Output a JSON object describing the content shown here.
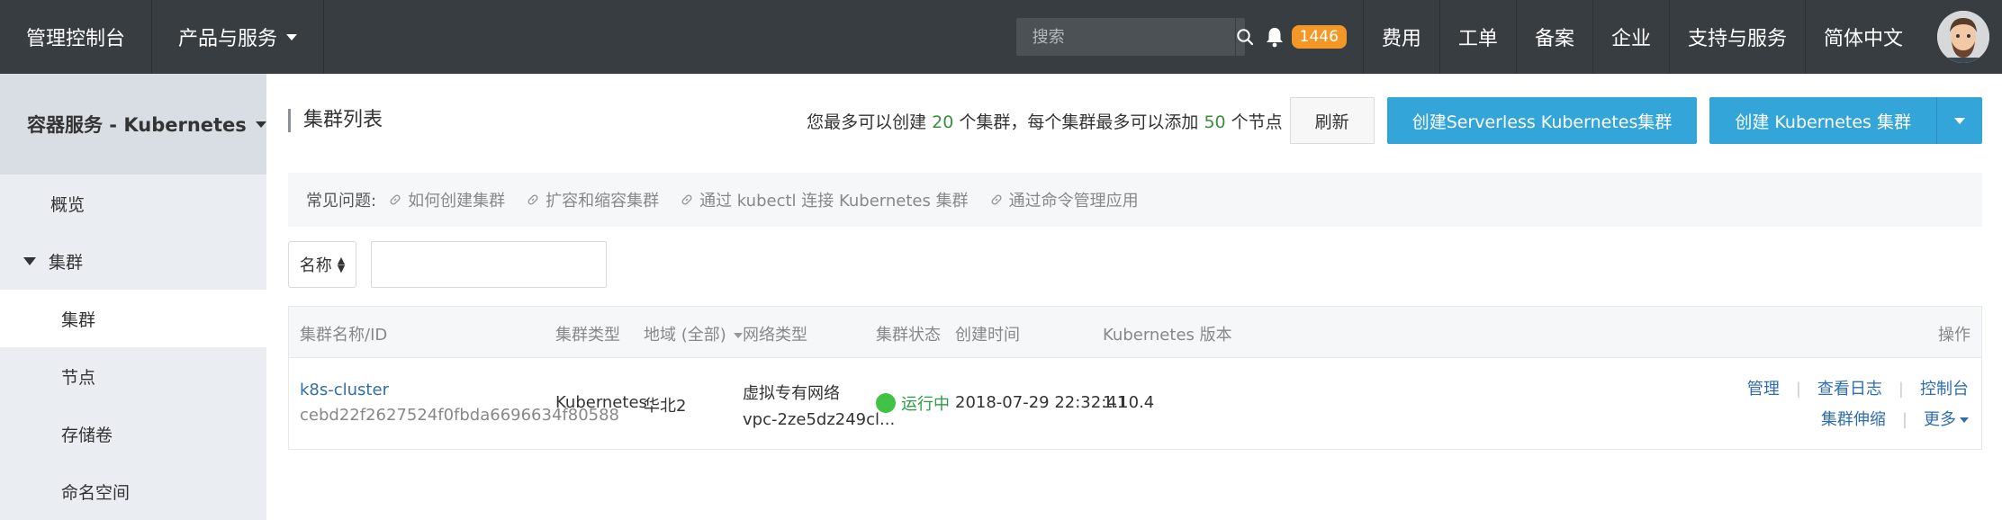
{
  "topbar": {
    "console_label": "管理控制台",
    "products_label": "产品与服务",
    "search_placeholder": "搜索",
    "notification_count": "1446",
    "nav": [
      "费用",
      "工单",
      "备案",
      "企业",
      "支持与服务",
      "简体中文"
    ]
  },
  "sidebar": {
    "header": "容器服务 - Kubernetes",
    "overview": "概览",
    "group": "集群",
    "items": [
      "集群",
      "节点",
      "存储卷",
      "命名空间"
    ]
  },
  "page": {
    "title": "集群列表",
    "quota": {
      "prefix": "您最多可以创建",
      "cluster_count": "20",
      "middle": "个集群，每个集群最多可以添加",
      "node_count": "50",
      "suffix": "个节点"
    },
    "refresh_label": "刷新",
    "create_serverless_label": "创建Serverless Kubernetes集群",
    "create_k8s_label": "创建 Kubernetes 集群"
  },
  "faq": {
    "label": "常见问题:",
    "links": [
      "如何创建集群",
      "扩容和缩容集群",
      "通过 kubectl 连接 Kubernetes 集群",
      "通过命令管理应用"
    ]
  },
  "filter": {
    "select_label": "名称",
    "input_value": ""
  },
  "table": {
    "columns": {
      "name": "集群名称/ID",
      "type": "集群类型",
      "region": "地域 (全部)",
      "network": "网络类型",
      "status": "集群状态",
      "created": "创建时间",
      "version": "Kubernetes 版本",
      "actions": "操作"
    },
    "rows": [
      {
        "name": "k8s-cluster",
        "id": "cebd22f2627524f0fbda6696634f80588",
        "type": "Kubernetes",
        "region": "华北2",
        "network": "虚拟专有网络",
        "vpc": "vpc-2ze5dz249cl...",
        "status": "运行中",
        "created": "2018-07-29 22:32:41",
        "version": "1.10.4",
        "actions": {
          "manage": "管理",
          "logs": "查看日志",
          "console": "控制台",
          "scale": "集群伸缩",
          "more": "更多"
        }
      }
    ]
  },
  "colors": {
    "topbar": "#373d41",
    "primary": "#34a5d8",
    "badge": "#f39826",
    "running": "#40c245",
    "link": "#2f6db0"
  }
}
